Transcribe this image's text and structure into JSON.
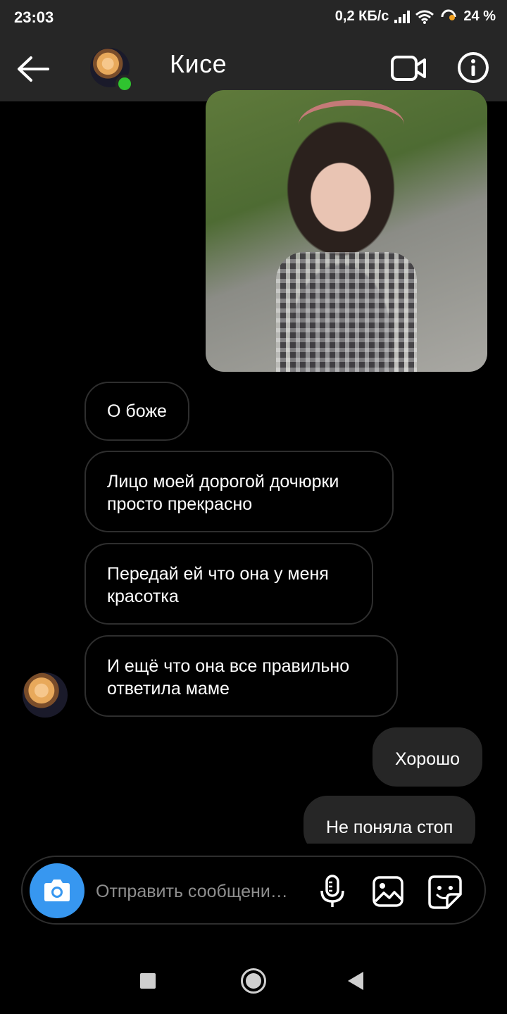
{
  "status_bar": {
    "time": "23:03",
    "network_speed": "0,2 КБ/с",
    "battery": "24 %",
    "icons": [
      "signal-icon",
      "wifi-icon",
      "alarm-icon",
      "battery-icon"
    ]
  },
  "header": {
    "contact_name": "Кисе",
    "online": true,
    "icons": [
      "back-arrow-icon",
      "video-call-icon",
      "info-icon"
    ]
  },
  "messages": [
    {
      "direction": "outgoing",
      "type": "photo",
      "description": "child photo"
    },
    {
      "direction": "incoming",
      "text": "О боже"
    },
    {
      "direction": "incoming",
      "text": "Лицо моей дорогой дочюрки просто прекрасно"
    },
    {
      "direction": "incoming",
      "text": "Передай ей что она у меня красотка"
    },
    {
      "direction": "incoming",
      "text": "И ещё что она все правильно ответила маме"
    },
    {
      "direction": "outgoing",
      "text": "Хорошо"
    },
    {
      "direction": "outgoing",
      "text": "Не поняла стоп"
    }
  ],
  "composer": {
    "placeholder": "Отправить сообщени…",
    "icons": [
      "camera-icon",
      "microphone-icon",
      "gallery-icon",
      "sticker-icon"
    ]
  },
  "colors": {
    "header_bg": "#262626",
    "accent": "#3797f0",
    "online": "#2fc32f",
    "outgoing_bubble": "#262626"
  },
  "navbar": {
    "icons": [
      "recent-apps-icon",
      "home-icon",
      "back-icon"
    ]
  }
}
